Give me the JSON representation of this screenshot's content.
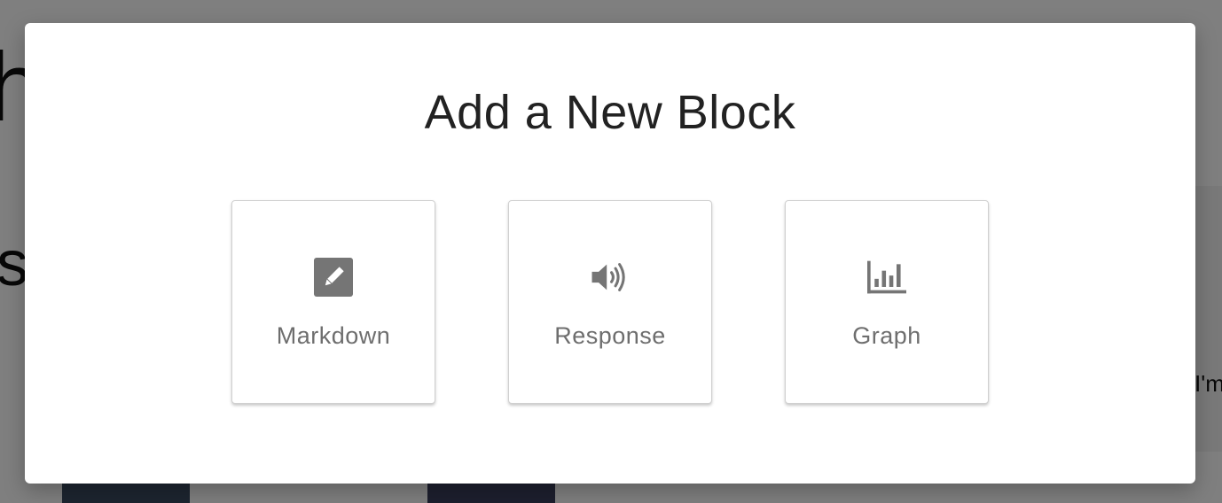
{
  "background": {
    "heading_fragment_1": "h",
    "heading_fragment_2": "s",
    "snippet_fragment": "I'm"
  },
  "modal": {
    "title": "Add a New Block",
    "options": [
      {
        "label": "Markdown",
        "icon": "pencil-edit-icon"
      },
      {
        "label": "Response",
        "icon": "speaker-volume-icon"
      },
      {
        "label": "Graph",
        "icon": "bar-chart-icon"
      }
    ]
  },
  "colors": {
    "overlay": "rgba(0,0,0,0.5)",
    "icon": "#757575",
    "label": "#6e6e6e",
    "title": "#222222"
  }
}
